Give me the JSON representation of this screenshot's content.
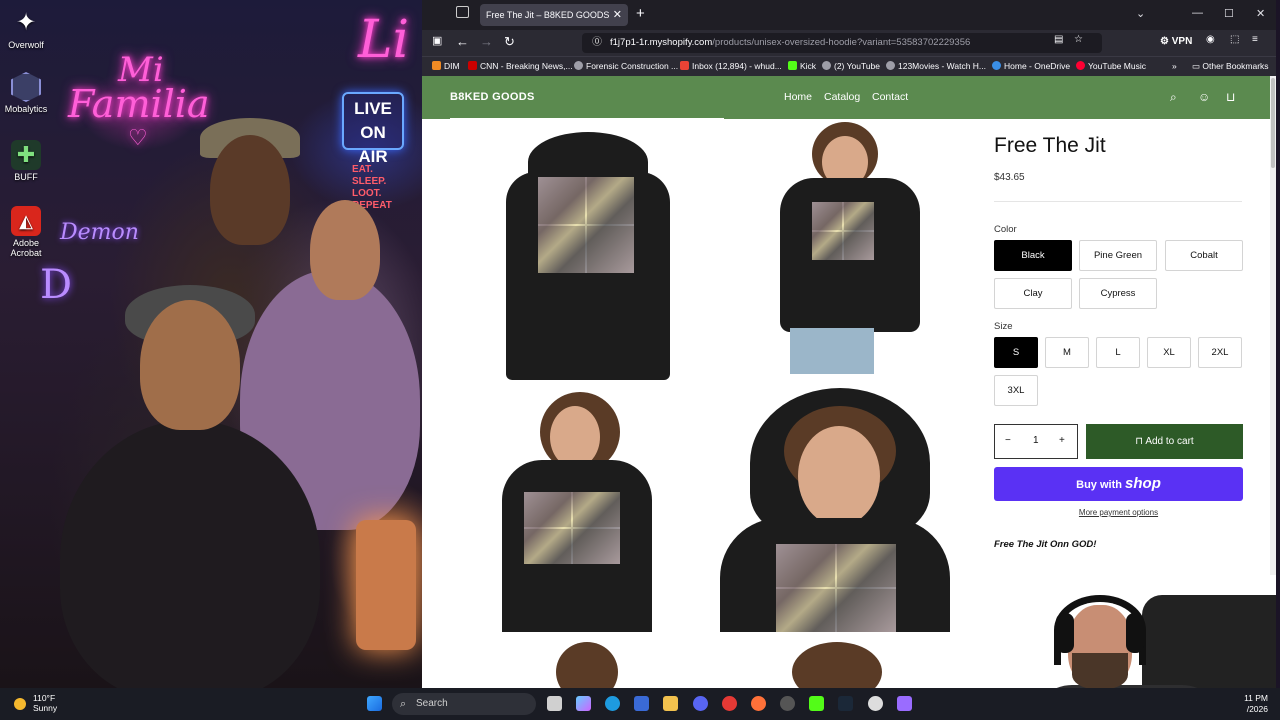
{
  "desktop": {
    "icons": [
      {
        "label": "Overwolf"
      },
      {
        "label": "Mobalytics"
      },
      {
        "label": "BUFF"
      },
      {
        "label": "Adobe Acrobat"
      }
    ],
    "wallpaper": {
      "neon_mi": "Mi",
      "neon_familia": "Familia",
      "neon_li": "Li",
      "live_sign": "LIVE ON AIR",
      "eat_sign": "EAT. SLEEP. LOOT. REPEAT",
      "neon_demon": "Demon",
      "neon_d": "D"
    }
  },
  "browser": {
    "tab_title": "Free The Jit – B8KED GOODS",
    "url_host": "f1j7p1-1r.myshopify.com",
    "url_path": "/products/unisex-oversized-hoodie?variant=53583702229356",
    "vpn_label": "VPN",
    "bookmarks": [
      {
        "label": "DIM",
        "color": "#f08a24"
      },
      {
        "label": "CNN - Breaking News,...",
        "color": "#cc0000"
      },
      {
        "label": "Forensic Construction ...",
        "color": "#9e9ea8"
      },
      {
        "label": "Inbox (12,894) - whud...",
        "color": "#ea4335"
      },
      {
        "label": "Kick",
        "color": "#53fc18"
      },
      {
        "label": "(2) YouTube",
        "color": "#9e9ea8"
      },
      {
        "label": "123Movies - Watch H...",
        "color": "#9e9ea8"
      },
      {
        "label": "Home - OneDrive",
        "color": "#3a8ee6"
      },
      {
        "label": "YouTube Music",
        "color": "#ff0033"
      }
    ],
    "other_bookmarks": "Other Bookmarks"
  },
  "store": {
    "brand": "B8KED GOODS",
    "nav": [
      "Home",
      "Catalog",
      "Contact"
    ],
    "accent_color": "#5b8a4f",
    "product": {
      "title": "Free The Jit",
      "price": "$43.65",
      "color_label": "Color",
      "colors": [
        "Black",
        "Pine Green",
        "Cobalt",
        "Clay",
        "Cypress"
      ],
      "selected_color": "Black",
      "size_label": "Size",
      "sizes": [
        "S",
        "M",
        "L",
        "XL",
        "2XL",
        "3XL"
      ],
      "selected_size": "S",
      "quantity": "1",
      "add_to_cart": "Add to cart",
      "buy_with": "Buy with",
      "shop_logo": "shop",
      "more_payment": "More payment options",
      "description": "Free The Jit Onn GOD!"
    }
  },
  "taskbar": {
    "weather_temp": "110°F",
    "weather_desc": "Sunny",
    "search_placeholder": "Search",
    "time": "11 PM",
    "date": "/2026"
  }
}
